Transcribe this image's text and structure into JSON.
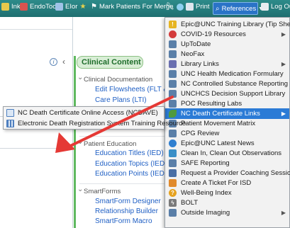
{
  "toolbar": {
    "items": [
      {
        "label": "Ink",
        "icon": "flag-icon"
      },
      {
        "label": "EndoTool",
        "icon": "endotool-icon"
      },
      {
        "label": "EI",
        "icon": "monitor-icon"
      },
      {
        "label": "or",
        "icon": "star-icon"
      },
      {
        "label": "Mark Patients For Merge",
        "icon": "people-icon"
      },
      {
        "label": "Print",
        "icon": "printer-icon"
      },
      {
        "label": "References",
        "icon": "search-icon"
      },
      {
        "label": "Log Out",
        "icon": "logout-icon"
      }
    ]
  },
  "clinical_content": {
    "title": "Clinical Content",
    "sections": [
      {
        "heading": "Clinical Documentation",
        "links": [
          "Edit Flowsheets (FLT & FL",
          "Care Plans (LTI)"
        ]
      },
      {
        "heading": "Patient Education",
        "links": [
          "Education Titles (IED)",
          "Education Topics (IED)",
          "Education Points (IED)"
        ]
      },
      {
        "heading": "SmartForms",
        "links": [
          "SmartForm Designer",
          "Relationship Builder",
          "SmartForm Macro"
        ]
      }
    ]
  },
  "references_menu": {
    "items": [
      {
        "label": "Epic@UNC Training Library (Tip Sheets)",
        "icon": "lightbulb-icon",
        "color": "#e6b422",
        "submenu": false
      },
      {
        "label": "COVID-19 Resources",
        "icon": "covid-icon",
        "color": "#d33b3b",
        "submenu": true
      },
      {
        "label": "UpToDate",
        "icon": "web-page-icon",
        "color": "#5a7fa8",
        "submenu": false
      },
      {
        "label": "NeoFax",
        "icon": "web-page-icon",
        "color": "#5a7fa8",
        "submenu": false
      },
      {
        "label": "Library Links",
        "icon": "library-icon",
        "color": "#6a6fb0",
        "submenu": true
      },
      {
        "label": "UNC Health Medication Formulary",
        "icon": "web-page-icon",
        "color": "#5a7fa8",
        "submenu": false
      },
      {
        "label": "NC Controlled Substance Reporting",
        "icon": "web-page-icon",
        "color": "#5a7fa8",
        "submenu": false
      },
      {
        "label": "UNCHCS Decision Support Library",
        "icon": "web-page-icon",
        "color": "#5a7fa8",
        "submenu": false
      },
      {
        "label": "POC Resulting Labs",
        "icon": "web-page-icon",
        "color": "#5a7fa8",
        "submenu": false
      },
      {
        "label": "NC Death Certificate Links",
        "icon": "leaf-icon",
        "color": "#4f9a3f",
        "submenu": true,
        "highlighted": true
      },
      {
        "label": "Patient Movement Matrix",
        "icon": "web-page-icon",
        "color": "#5a7fa8",
        "submenu": false
      },
      {
        "label": "CPG Review",
        "icon": "web-page-icon",
        "color": "#5a7fa8",
        "submenu": false
      },
      {
        "label": "Epic@UNC Latest News",
        "icon": "globe-icon",
        "color": "#2f7fd0",
        "submenu": false
      },
      {
        "label": "Clean In, Clean Out Observations",
        "icon": "hand-icon",
        "color": "#3a8fc7",
        "submenu": false
      },
      {
        "label": "SAFE Reporting",
        "icon": "web-page-icon",
        "color": "#5a7fa8",
        "submenu": false
      },
      {
        "label": "Request a Provider Coaching Session",
        "icon": "people-icon",
        "color": "#4a6fa5",
        "submenu": false
      },
      {
        "label": "Create A Ticket For ISD",
        "icon": "ticket-icon",
        "color": "#e08a2c",
        "submenu": false
      },
      {
        "label": "Well-Being Index",
        "icon": "question-icon",
        "color": "#e6a21f",
        "submenu": false
      },
      {
        "label": "BOLT",
        "icon": "bolt-icon",
        "color": "#7a7a7a",
        "submenu": false
      },
      {
        "label": "Outside Imaging",
        "icon": "web-page-icon",
        "color": "#5a7fa8",
        "submenu": true
      }
    ]
  },
  "death_certificate_submenu": {
    "items": [
      {
        "label": "NC Death Certificate Online Access (NCDAVE)",
        "icon": "web-page-icon"
      },
      {
        "label": "Electronic Death Registration System Training Resource",
        "icon": "grid-icon"
      }
    ]
  },
  "colors": {
    "toolbar": "#1f6f70",
    "menu_highlight": "#2b7bd6",
    "link": "#1f5fc4",
    "annotation_arrow": "#e53935"
  }
}
